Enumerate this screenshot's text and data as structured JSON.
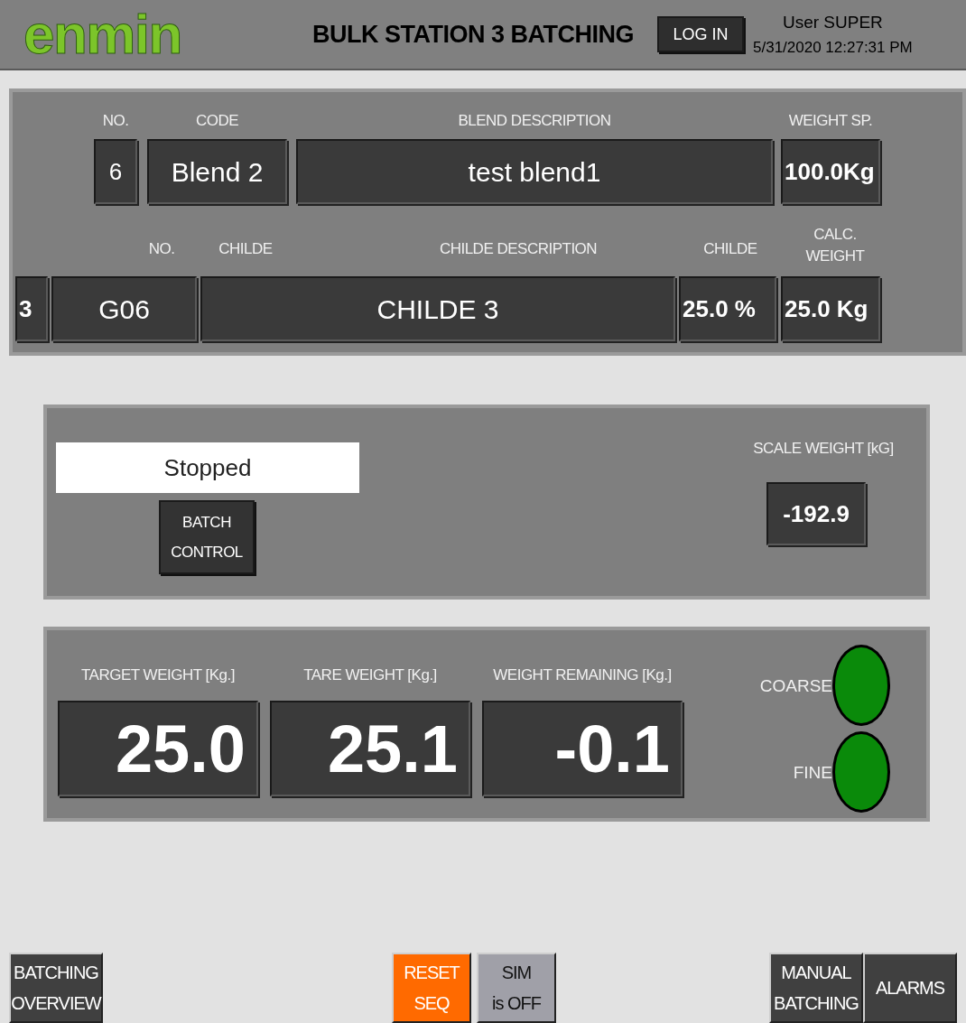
{
  "header": {
    "logo": "enmin",
    "title": "BULK STATION 3 BATCHING",
    "login_button": "LOG IN",
    "user": "User SUPER",
    "datetime": "5/31/2020 12:27:31 PM"
  },
  "blend": {
    "labels": {
      "no": "NO.",
      "code": "CODE",
      "description": "BLEND DESCRIPTION",
      "weight_sp": "WEIGHT SP."
    },
    "no": "6",
    "code": "Blend 2",
    "description": "test blend1",
    "weight_sp": "100.0Kg"
  },
  "childe": {
    "labels": {
      "no": "NO.",
      "childe": "CHILDE",
      "description": "CHILDE DESCRIPTION",
      "percent": "CHILDE",
      "calc_weight": [
        "CALC.",
        "WEIGHT"
      ]
    },
    "index": "3",
    "no": "G06",
    "description": "CHILDE 3",
    "percent": "25.0 %",
    "calc_weight": "25.0 Kg"
  },
  "batch": {
    "status": "Stopped",
    "control_button": [
      "BATCH",
      "CONTROL"
    ],
    "scale_label": "SCALE WEIGHT [kG]",
    "scale_weight": "-192.9"
  },
  "weights": [
    {
      "label": "TARGET WEIGHT [Kg.]",
      "value": "25.0"
    },
    {
      "label": "TARE WEIGHT [Kg.]",
      "value": "25.1"
    },
    {
      "label": "WEIGHT REMAINING [Kg.]",
      "value": "-0.1"
    }
  ],
  "lamps": [
    {
      "label": "COARSE",
      "on": true
    },
    {
      "label": "FINE",
      "on": true
    }
  ],
  "footer_left": [
    {
      "lines": [
        "BATCHING",
        "OVERVIEW"
      ],
      "color": "#404040"
    }
  ],
  "footer_center": [
    {
      "lines": [
        "RESET",
        "SEQ"
      ],
      "color": "#ff6a00"
    },
    {
      "lines": [
        "SIM",
        "is OFF"
      ],
      "color": "#a0a0a8"
    }
  ],
  "footer_right": [
    {
      "lines": [
        "MANUAL",
        "BATCHING"
      ],
      "color": "#404040"
    },
    {
      "lines": [
        "ALARMS"
      ],
      "color": "#404040"
    }
  ]
}
